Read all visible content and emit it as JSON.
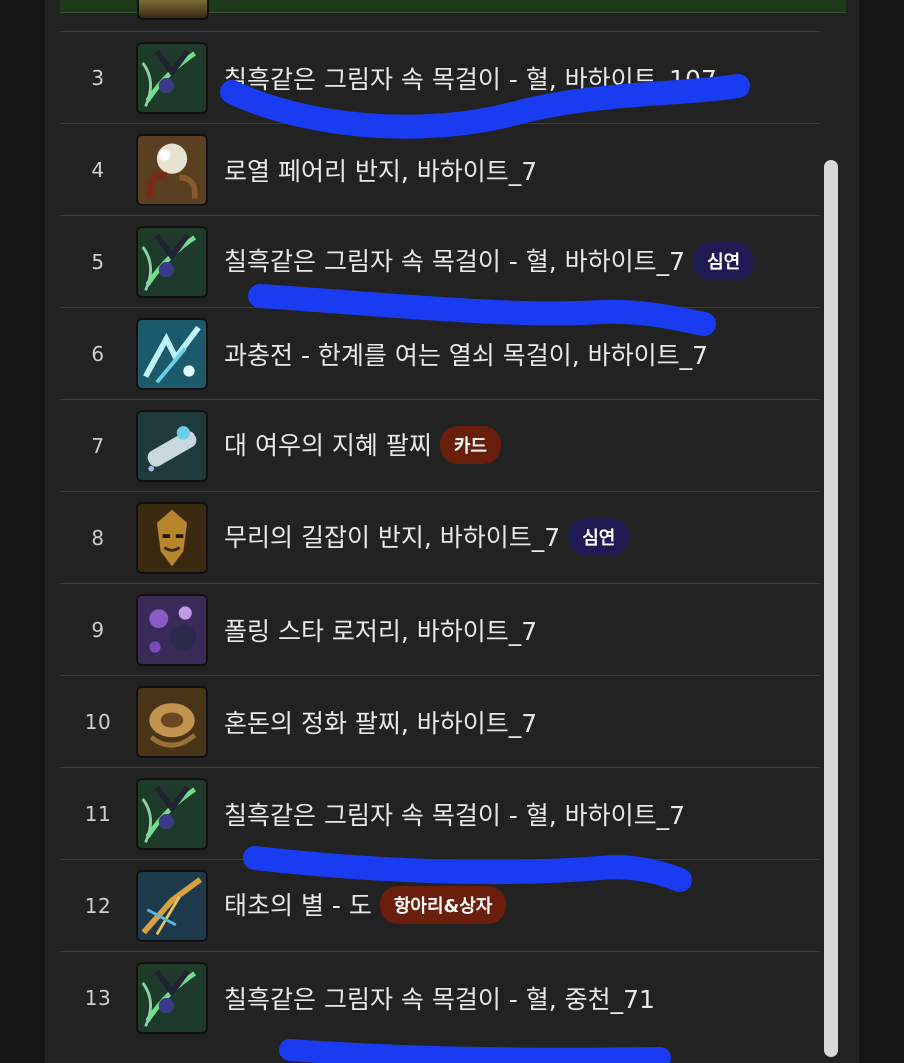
{
  "items": [
    {
      "rank": "3",
      "name": "칠흑같은 그림자 속 목걸이 - 혈, 바하이트_107",
      "badge": "",
      "icon": "dark-necklace-icon"
    },
    {
      "rank": "4",
      "name": "로열 페어리 반지, 바하이트_7",
      "badge": "",
      "icon": "royal-fairy-ring-icon"
    },
    {
      "rank": "5",
      "name": "칠흑같은 그림자 속 목걸이 - 혈, 바하이트_7",
      "badge": "심연",
      "badge_color": "#1f1a52",
      "icon": "dark-necklace-icon"
    },
    {
      "rank": "6",
      "name": "과충전 - 한계를 여는 열쇠 목걸이, 바하이트_7",
      "badge": "",
      "icon": "overcharge-necklace-icon"
    },
    {
      "rank": "7",
      "name": "대 여우의 지혜 팔찌",
      "badge": "카드",
      "badge_color": "#6a1f0d",
      "icon": "fox-bracelet-icon"
    },
    {
      "rank": "8",
      "name": "무리의 길잡이 반지, 바하이트_7",
      "badge": "심연",
      "badge_color": "#1f1a52",
      "icon": "guide-ring-icon"
    },
    {
      "rank": "9",
      "name": "폴링 스타 로저리, 바하이트_7",
      "badge": "",
      "icon": "falling-star-rosary-icon"
    },
    {
      "rank": "10",
      "name": "혼돈의 정화 팔찌, 바하이트_7",
      "badge": "",
      "icon": "chaos-bracelet-icon"
    },
    {
      "rank": "11",
      "name": "칠흑같은 그림자 속 목걸이 - 혈, 바하이트_7",
      "badge": "",
      "icon": "dark-necklace-icon"
    },
    {
      "rank": "12",
      "name": "태초의 별 - 도",
      "badge": "항아리&상자",
      "badge_color": "#6a1f0d",
      "icon": "primordial-star-icon"
    },
    {
      "rank": "13",
      "name": "칠흑같은 그림자 속 목걸이 - 혈, 중천_71",
      "badge": "",
      "icon": "dark-necklace-icon"
    }
  ],
  "colors": {
    "background": "#222222",
    "scribble": "#1a3cf0",
    "badge_navy": "#1f1a52",
    "badge_rust": "#6a1f0d"
  }
}
